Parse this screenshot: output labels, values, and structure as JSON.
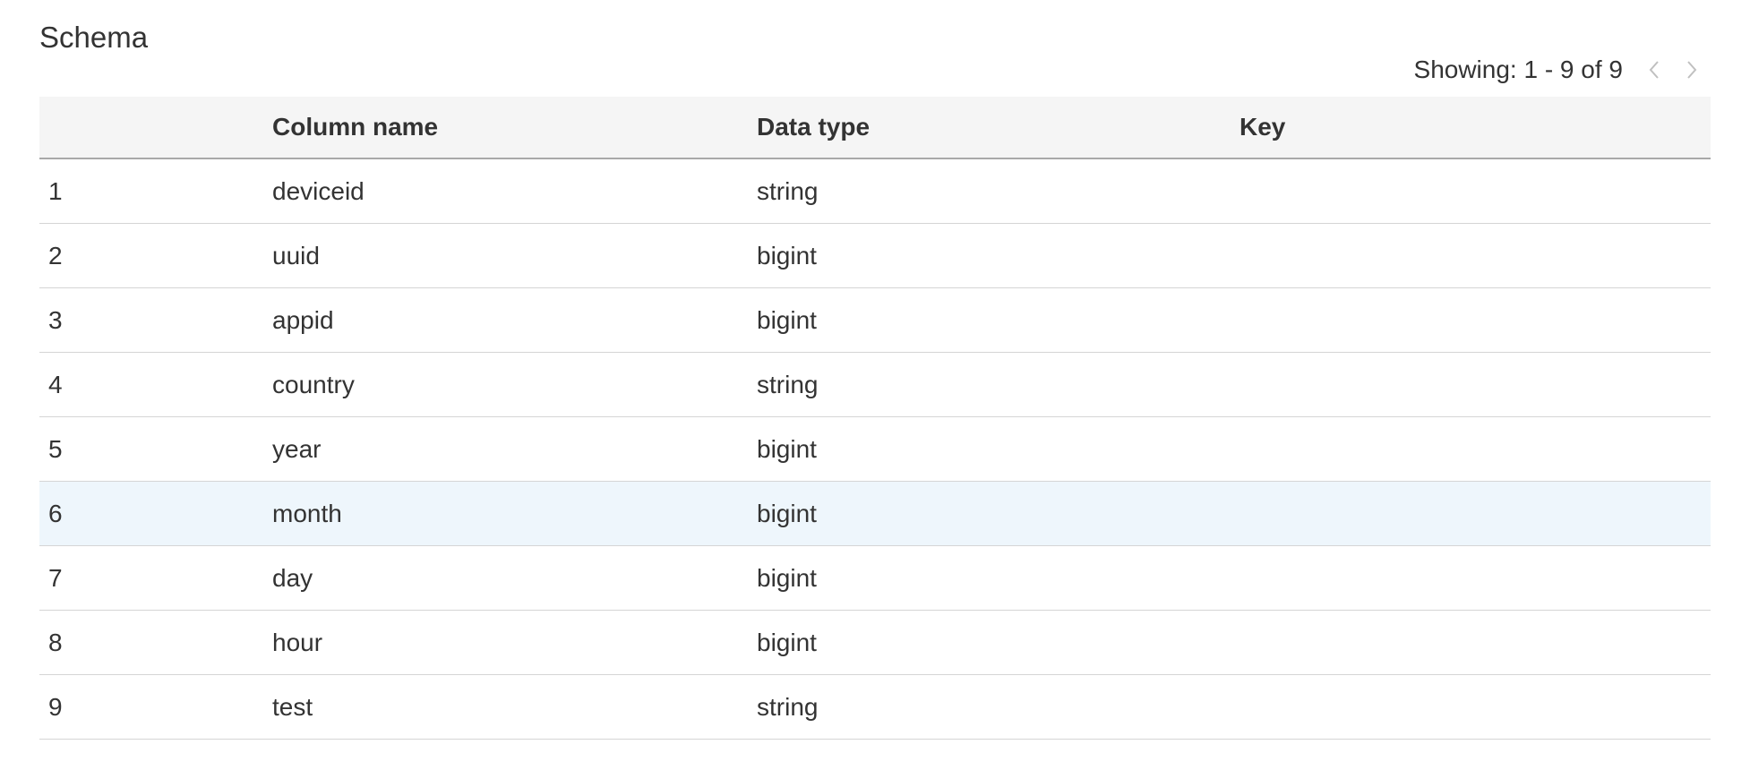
{
  "panel": {
    "title": "Schema"
  },
  "pagination": {
    "text": "Showing: 1 - 9 of 9",
    "prev_icon": "chevron-left-icon",
    "next_icon": "chevron-right-icon"
  },
  "table": {
    "columns": [
      "",
      "Column name",
      "Data type",
      "Key"
    ],
    "rows": [
      {
        "index": "1",
        "name": "deviceid",
        "type": "string",
        "key": ""
      },
      {
        "index": "2",
        "name": "uuid",
        "type": "bigint",
        "key": ""
      },
      {
        "index": "3",
        "name": "appid",
        "type": "bigint",
        "key": ""
      },
      {
        "index": "4",
        "name": "country",
        "type": "string",
        "key": ""
      },
      {
        "index": "5",
        "name": "year",
        "type": "bigint",
        "key": ""
      },
      {
        "index": "6",
        "name": "month",
        "type": "bigint",
        "key": ""
      },
      {
        "index": "7",
        "name": "day",
        "type": "bigint",
        "key": ""
      },
      {
        "index": "8",
        "name": "hour",
        "type": "bigint",
        "key": ""
      },
      {
        "index": "9",
        "name": "test",
        "type": "string",
        "key": ""
      }
    ],
    "highlighted_row": 5
  },
  "colors": {
    "header_bg": "#f5f5f5",
    "row_highlight": "#eef6fc",
    "text": "#333333",
    "disabled_icon": "#c0c0c0"
  }
}
